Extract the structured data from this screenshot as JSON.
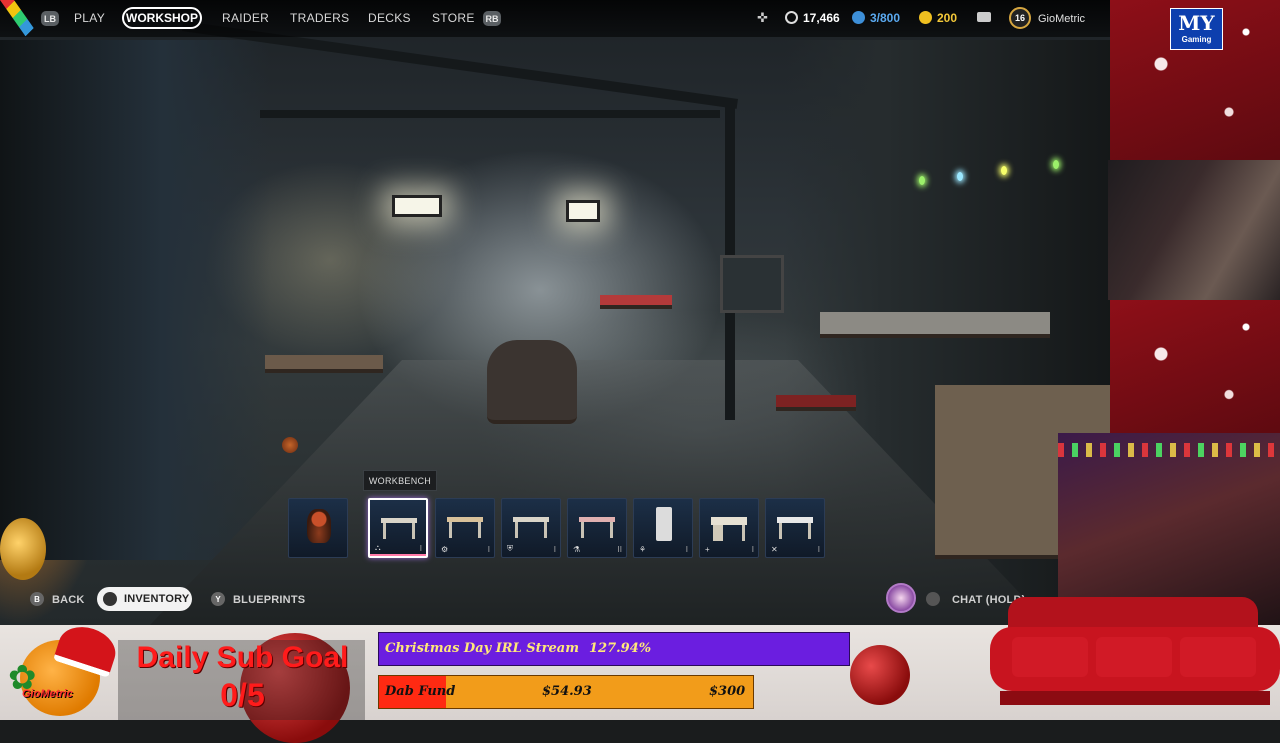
{
  "nav": {
    "lb": "LB",
    "rb": "RB",
    "items": [
      "PLAY",
      "WORKSHOP",
      "RAIDER",
      "TRADERS",
      "DECKS",
      "STORE"
    ],
    "active": "WORKSHOP"
  },
  "stats": {
    "currency1": "17,466",
    "currency2": "3/800",
    "currency3": "200",
    "level": "16",
    "username": "GioMetric"
  },
  "tooltip": "WORKBENCH",
  "slots": [
    {
      "name": "rooster",
      "icon": "",
      "bar": ""
    },
    {
      "name": "workbench",
      "icon": "⛬",
      "bar": "I"
    },
    {
      "name": "table",
      "icon": "⚙",
      "bar": "I"
    },
    {
      "name": "bench-shield",
      "icon": "⛨",
      "bar": "I"
    },
    {
      "name": "bench-bio",
      "icon": "⚗",
      "bar": "II"
    },
    {
      "name": "cabinet",
      "icon": "⚘",
      "bar": "I"
    },
    {
      "name": "desk-medical",
      "icon": "+",
      "bar": "I"
    },
    {
      "name": "desk-tools",
      "icon": "✕",
      "bar": "I"
    }
  ],
  "bottom": {
    "back_key": "B",
    "back": "BACK",
    "inventory": "INVENTORY",
    "blueprints_key": "Y",
    "blueprints": "BLUEPRINTS",
    "chat": "CHAT (HOLD)"
  },
  "overlay": {
    "logo_text": "MY",
    "logo_sub": "Gaming",
    "brand": "GioMetric",
    "subgoal_title": "Daily Sub Goal",
    "subgoal_count": "0/5",
    "bar1_label": "Christmas Day IRL Stream",
    "bar1_value": "127.94%",
    "bar2_label": "Dab Fund",
    "bar2_value": "$54.93",
    "bar2_goal": "$300",
    "bar2_progress": 0.18
  },
  "colors": {
    "accent_purple": "#6b1ee0",
    "fund_red": "#ff2a12",
    "fund_orange": "#f29c1a",
    "goal_red": "#ff1b1b",
    "panel_red": "#7a0d14"
  }
}
